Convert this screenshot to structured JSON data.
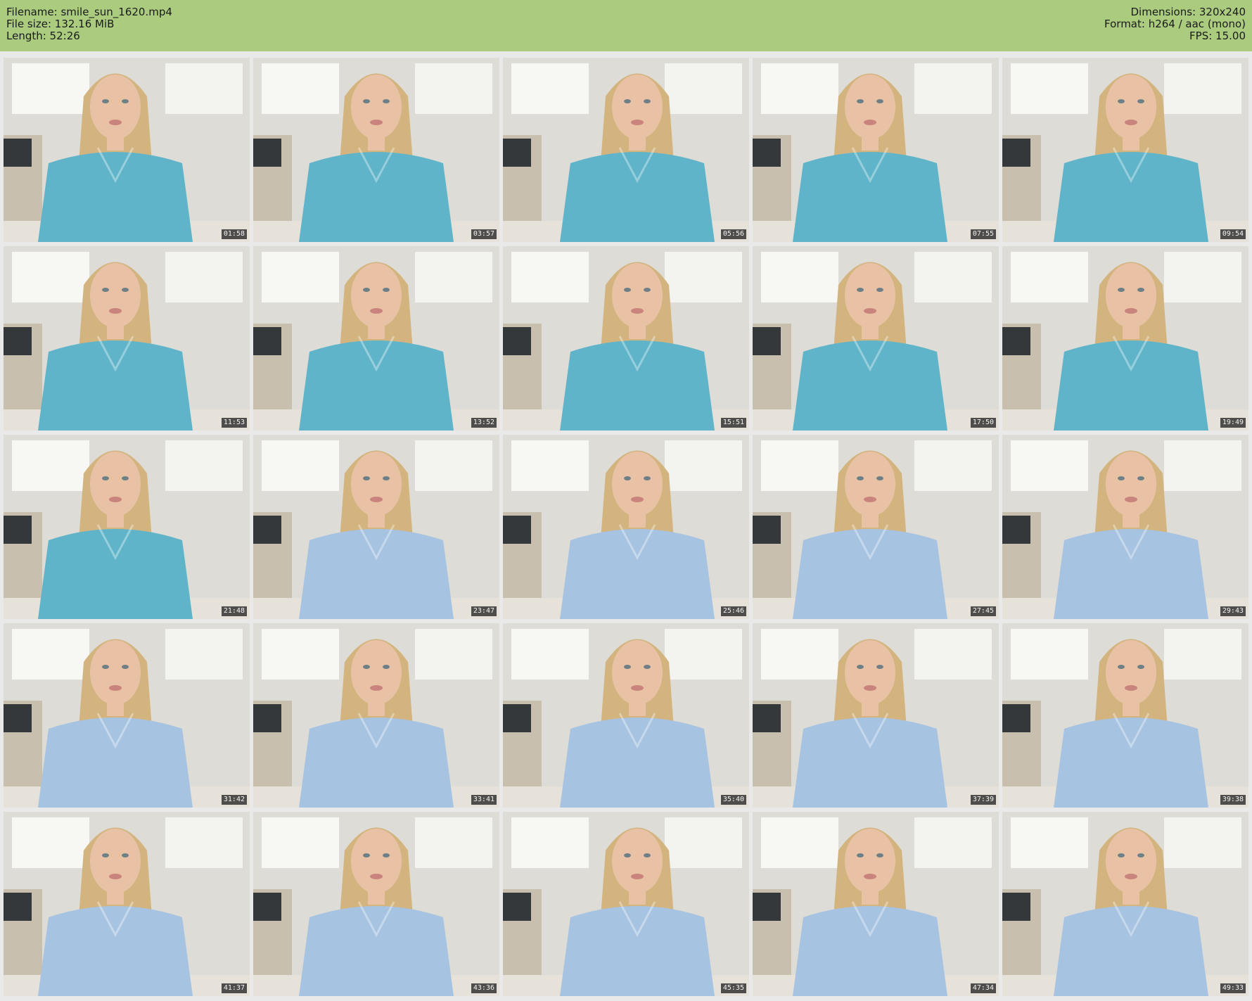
{
  "header": {
    "filename": "Filename: smile_sun_1620.mp4",
    "filesize": "File size: 132.16 MiB",
    "length": "Length: 52:26",
    "dimensions": "Dimensions: 320x240",
    "format": "Format: h264 / aac (mono)",
    "fps": "FPS: 15.00"
  },
  "colors": {
    "header_bg": "#abcc7f",
    "page_bg": "#e9e9e9",
    "shirt_teal": "#5fb4c9",
    "shirt_blue": "#a7c3e2"
  },
  "thumbnails": [
    {
      "time": "01:58"
    },
    {
      "time": "03:57"
    },
    {
      "time": "05:56"
    },
    {
      "time": "07:55"
    },
    {
      "time": "09:54"
    },
    {
      "time": "11:53"
    },
    {
      "time": "13:52"
    },
    {
      "time": "15:51"
    },
    {
      "time": "17:50"
    },
    {
      "time": "19:49"
    },
    {
      "time": "21:48"
    },
    {
      "time": "23:47"
    },
    {
      "time": "25:46"
    },
    {
      "time": "27:45"
    },
    {
      "time": "29:43"
    },
    {
      "time": "31:42"
    },
    {
      "time": "33:41"
    },
    {
      "time": "35:40"
    },
    {
      "time": "37:39"
    },
    {
      "time": "39:38"
    },
    {
      "time": "41:37"
    },
    {
      "time": "43:36"
    },
    {
      "time": "45:35"
    },
    {
      "time": "47:34"
    },
    {
      "time": "49:33"
    }
  ]
}
